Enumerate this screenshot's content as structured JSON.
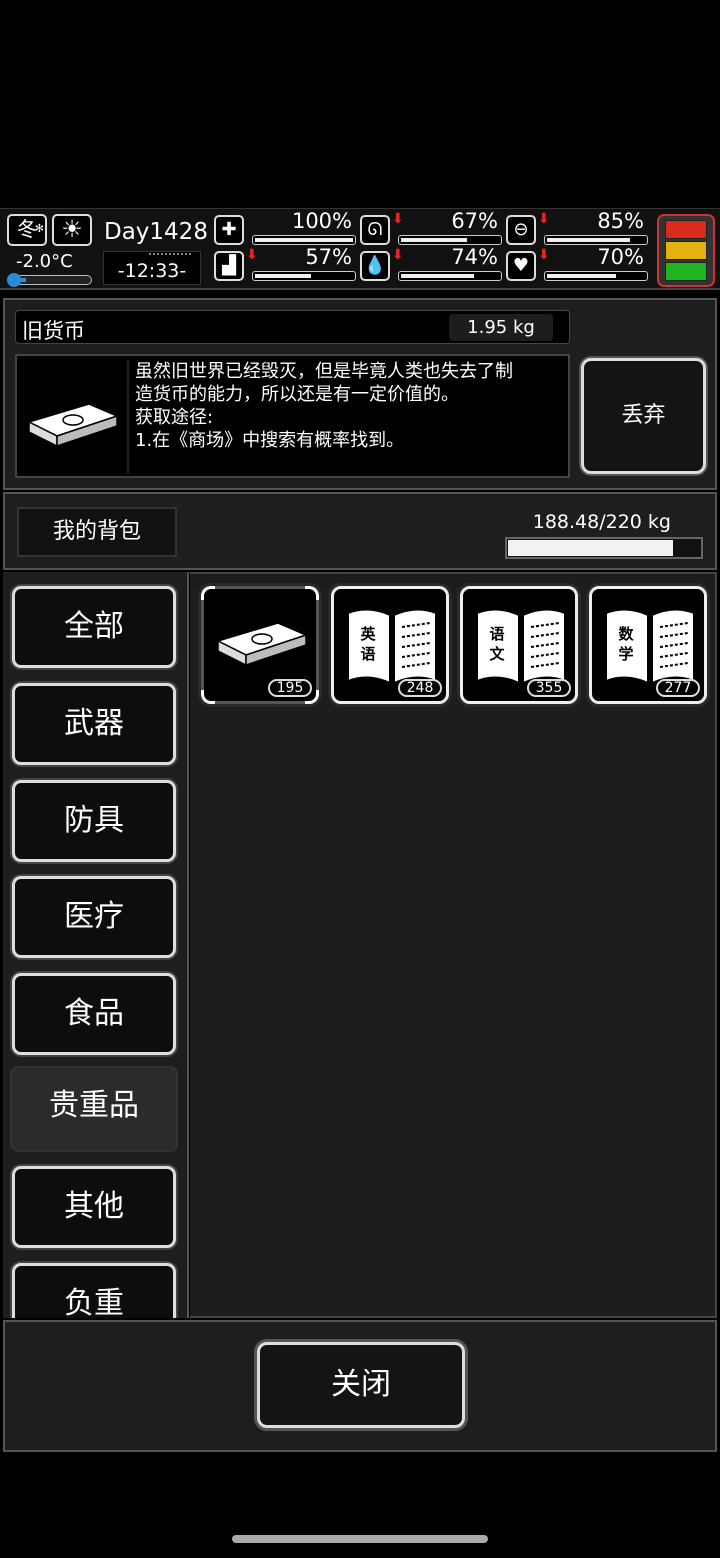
{
  "status": {
    "season": "冬",
    "temperature": "-2.0°C",
    "temperature_level": 0.15,
    "day": "Day1428",
    "time": "-12:33-",
    "stats": [
      {
        "icon": "medkit-icon",
        "value": "100%",
        "level": 1.0,
        "down": false
      },
      {
        "icon": "stomach-icon",
        "value": "67%",
        "level": 0.67,
        "down": true
      },
      {
        "icon": "pill-icon",
        "value": "85%",
        "level": 0.85,
        "down": true
      },
      {
        "icon": "foot-icon",
        "value": "57%",
        "level": 0.57,
        "down": true
      },
      {
        "icon": "water-drop-icon",
        "value": "74%",
        "level": 0.74,
        "down": true
      },
      {
        "icon": "heart-icon",
        "value": "70%",
        "level": 0.7,
        "down": true
      }
    ],
    "traffic_light": [
      "#d92b1c",
      "#e3b112",
      "#1eb51e"
    ]
  },
  "item": {
    "name": "旧货币",
    "weight": "1.95 kg",
    "description": [
      "虽然旧世界已经毁灭，但是毕竟人类也失去了制",
      "造货币的能力，所以还是有一定价值的。",
      "获取途径:",
      "1.在《商场》中搜索有概率找到。"
    ],
    "discard_label": "丢弃"
  },
  "bag": {
    "title": "我的背包",
    "weight_text": "188.48/220 kg",
    "weight_fraction": 0.857
  },
  "categories": [
    "全部",
    "武器",
    "防具",
    "医疗",
    "食品",
    "贵重品",
    "其他",
    "负重"
  ],
  "active_category": "贵重品",
  "slots": [
    {
      "icon": "money-stack-icon",
      "count": "195",
      "selected": true
    },
    {
      "icon": "english-book-icon",
      "label": "英语",
      "count": "248",
      "selected": false
    },
    {
      "icon": "chinese-book-icon",
      "label": "语文",
      "count": "355",
      "selected": false
    },
    {
      "icon": "math-book-icon",
      "label": "数学",
      "count": "277",
      "selected": false
    }
  ],
  "close_label": "关闭"
}
